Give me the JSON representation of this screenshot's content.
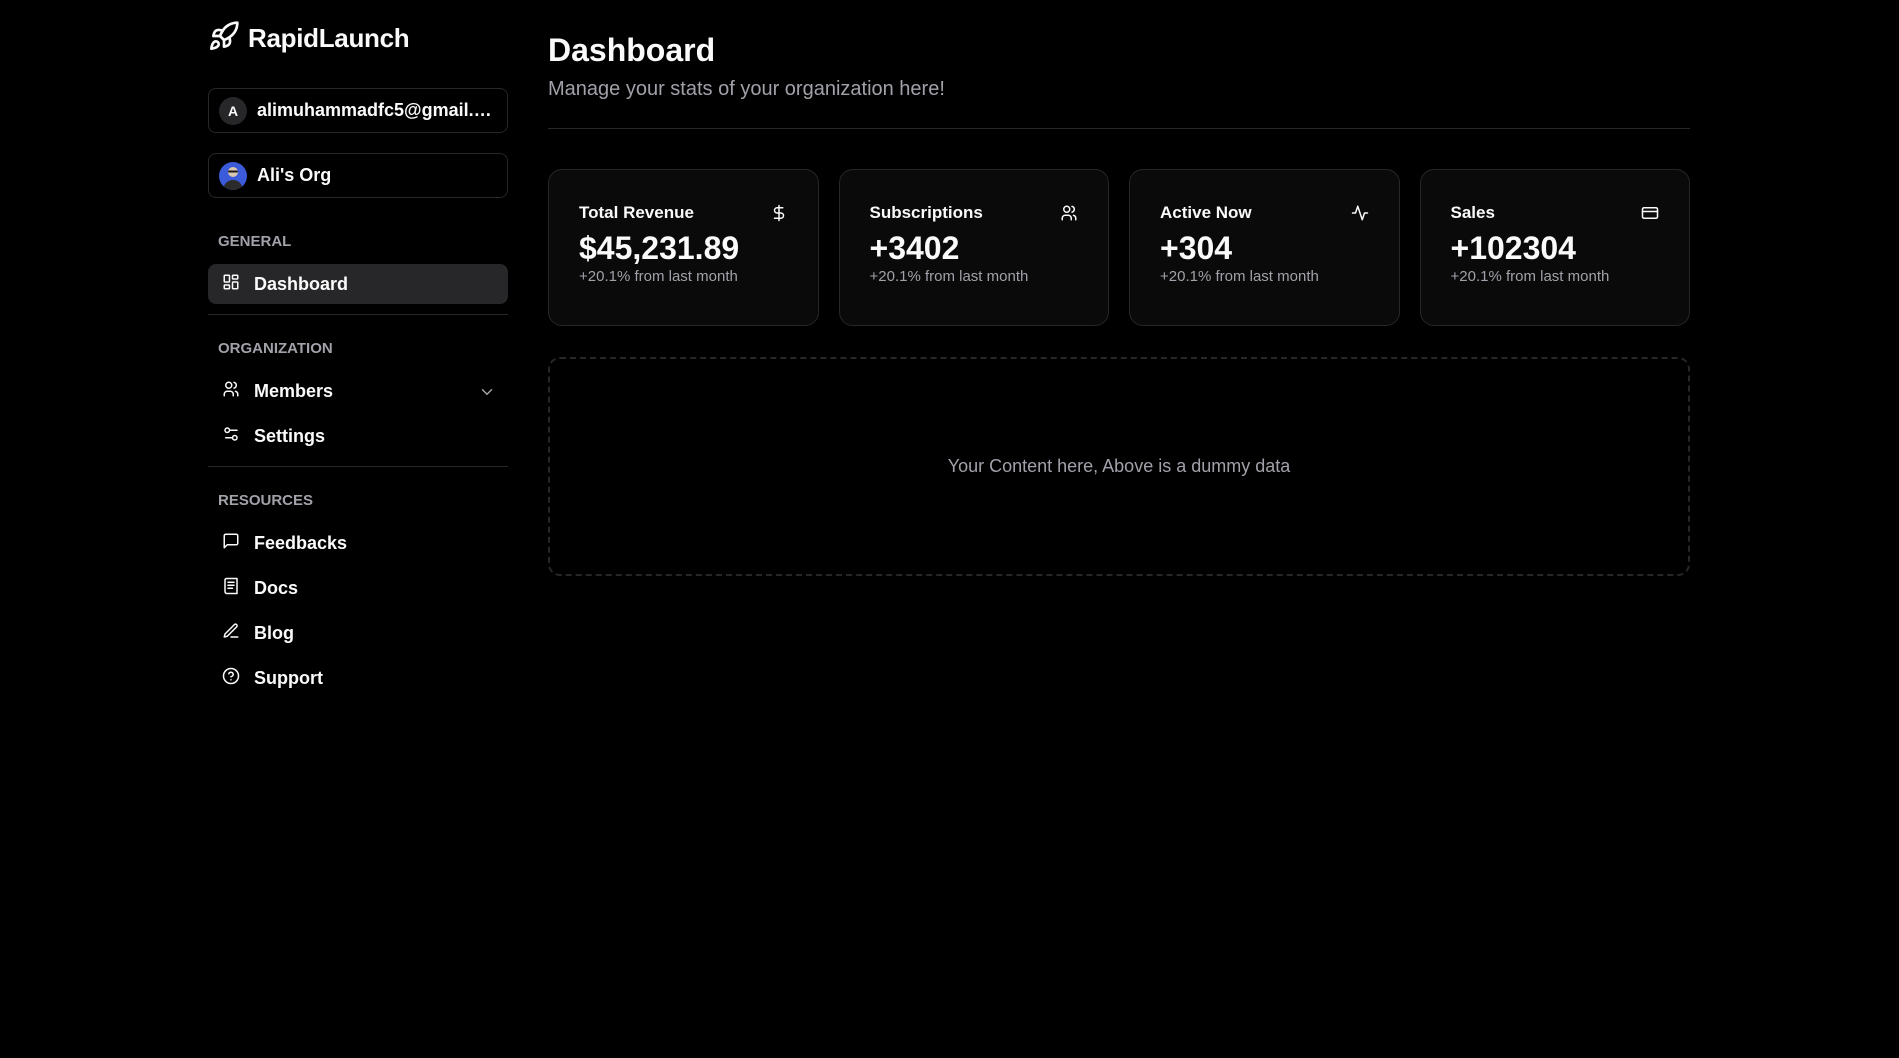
{
  "brand": {
    "name": "RapidLaunch",
    "icon": "rocket-icon"
  },
  "account": {
    "avatar_letter": "A",
    "email": "alimuhammadfc5@gmail.c..."
  },
  "organization": {
    "name": "Ali's Org"
  },
  "sidebar": {
    "general": {
      "label": "GENERAL",
      "items": [
        {
          "label": "Dashboard",
          "icon": "layout-grid-icon"
        }
      ]
    },
    "organization": {
      "label": "ORGANIZATION",
      "items": [
        {
          "label": "Members",
          "icon": "users-icon"
        },
        {
          "label": "Settings",
          "icon": "sliders-icon"
        }
      ]
    },
    "resources": {
      "label": "RESOURCES",
      "items": [
        {
          "label": "Feedbacks",
          "icon": "message-square-icon"
        },
        {
          "label": "Docs",
          "icon": "document-icon"
        },
        {
          "label": "Blog",
          "icon": "pen-icon"
        },
        {
          "label": "Support",
          "icon": "help-circle-icon"
        }
      ]
    }
  },
  "page": {
    "title": "Dashboard",
    "subtitle": "Manage your stats of your organization here!"
  },
  "stats": [
    {
      "title": "Total Revenue",
      "value": "$45,231.89",
      "change": "+20.1% from last month",
      "icon": "dollar-icon"
    },
    {
      "title": "Subscriptions",
      "value": "+3402",
      "change": "+20.1% from last month",
      "icon": "users-icon"
    },
    {
      "title": "Active Now",
      "value": "+304",
      "change": "+20.1% from last month",
      "icon": "activity-icon"
    },
    {
      "title": "Sales",
      "value": "+102304",
      "change": "+20.1% from last month",
      "icon": "credit-card-icon"
    }
  ],
  "placeholder": {
    "text": "Your Content here, Above is a dummy data"
  },
  "colors": {
    "background": "#000000",
    "card_background": "#0a0a0a",
    "border": "#27272a",
    "active_item": "#27272a",
    "text": "#fafafa",
    "muted_text": "#a1a1aa"
  }
}
